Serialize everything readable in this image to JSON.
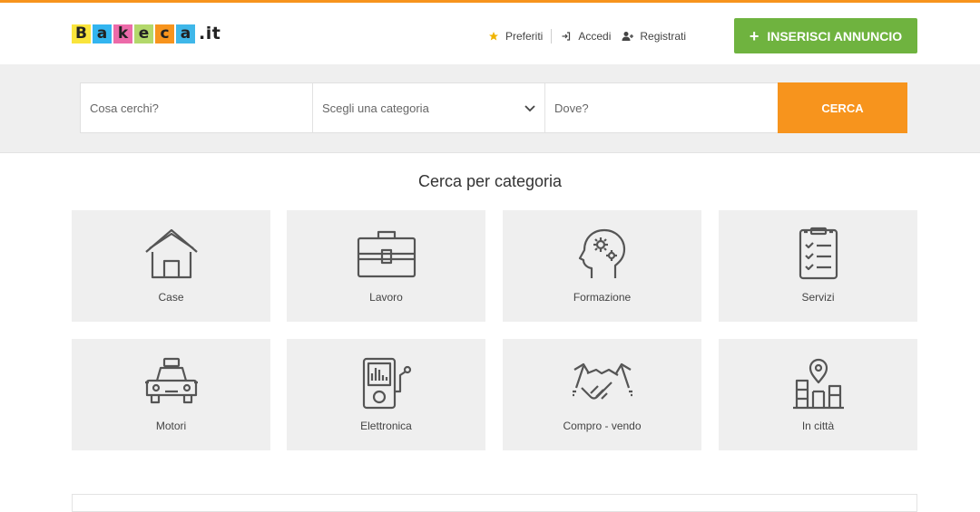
{
  "header": {
    "logo_letters": [
      "B",
      "a",
      "k",
      "e",
      "c",
      "a"
    ],
    "logo_tld": ".it",
    "colors": [
      "#f9e43b",
      "#33b5f0",
      "#ec6aa9",
      "#b3d86b",
      "#f7941d",
      "#3fb7e9"
    ],
    "nav": {
      "favorites": "Preferiti",
      "login": "Accedi",
      "register": "Registrati"
    },
    "insert_button": "INSERISCI ANNUNCIO",
    "accent_color": "#f7941d",
    "green_color": "#6fb33f"
  },
  "search": {
    "what_placeholder": "Cosa cerchi?",
    "category_placeholder": "Scegli una categoria",
    "where_placeholder": "Dove?",
    "button": "CERCA"
  },
  "categories": {
    "title": "Cerca per categoria",
    "items": [
      {
        "label": "Case",
        "icon": "house-icon"
      },
      {
        "label": "Lavoro",
        "icon": "briefcase-icon"
      },
      {
        "label": "Formazione",
        "icon": "head-gears-icon"
      },
      {
        "label": "Servizi",
        "icon": "checklist-icon"
      },
      {
        "label": "Motori",
        "icon": "taxi-icon"
      },
      {
        "label": "Elettronica",
        "icon": "music-player-icon"
      },
      {
        "label": "Compro - vendo",
        "icon": "handshake-icon"
      },
      {
        "label": "In città",
        "icon": "city-map-pin-icon"
      }
    ]
  }
}
